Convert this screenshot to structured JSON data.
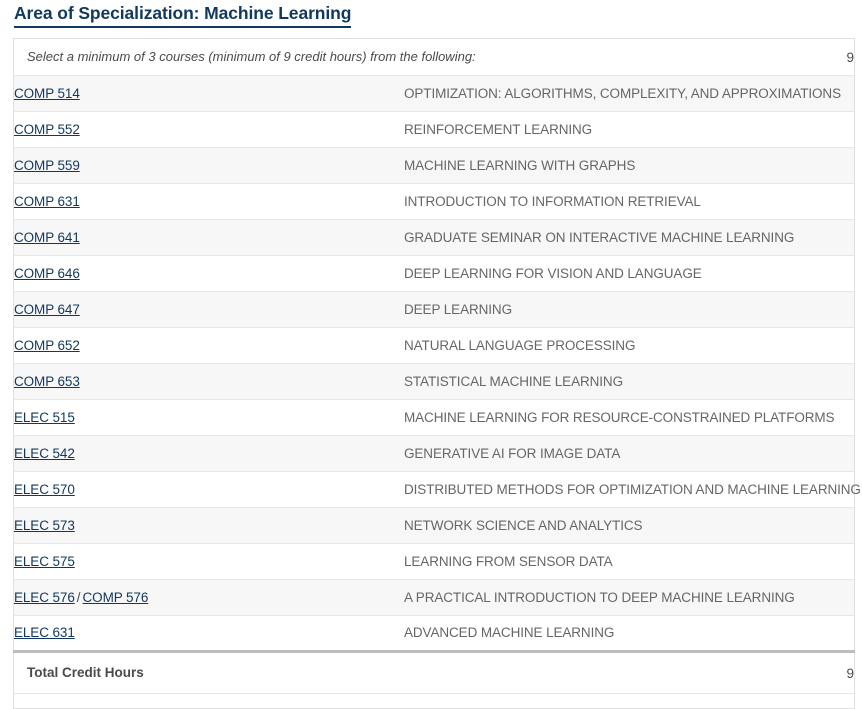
{
  "section": {
    "title": "Area of Specialization: Machine Learning"
  },
  "table": {
    "area_header": {
      "text": "Select a minimum of 3 courses (minimum of 9 credit hours) from the following:",
      "hours": "9"
    },
    "separator": "/",
    "rows": [
      {
        "codes": [
          "COMP 514"
        ],
        "title": "OPTIMIZATION: ALGORITHMS, COMPLEXITY, AND APPROXIMATIONS",
        "hours": ""
      },
      {
        "codes": [
          "COMP 552"
        ],
        "title": "REINFORCEMENT LEARNING",
        "hours": ""
      },
      {
        "codes": [
          "COMP 559"
        ],
        "title": "MACHINE LEARNING WITH GRAPHS",
        "hours": ""
      },
      {
        "codes": [
          "COMP 631"
        ],
        "title": "INTRODUCTION TO INFORMATION RETRIEVAL",
        "hours": ""
      },
      {
        "codes": [
          "COMP 641"
        ],
        "title": "GRADUATE SEMINAR ON INTERACTIVE MACHINE LEARNING",
        "hours": ""
      },
      {
        "codes": [
          "COMP 646"
        ],
        "title": "DEEP LEARNING FOR VISION AND LANGUAGE",
        "hours": ""
      },
      {
        "codes": [
          "COMP 647"
        ],
        "title": "DEEP LEARNING",
        "hours": ""
      },
      {
        "codes": [
          "COMP 652"
        ],
        "title": "NATURAL LANGUAGE PROCESSING",
        "hours": ""
      },
      {
        "codes": [
          "COMP 653"
        ],
        "title": "STATISTICAL MACHINE LEARNING",
        "hours": ""
      },
      {
        "codes": [
          "ELEC 515"
        ],
        "title": "MACHINE LEARNING FOR RESOURCE-CONSTRAINED PLATFORMS",
        "hours": ""
      },
      {
        "codes": [
          "ELEC 542"
        ],
        "title": "GENERATIVE AI FOR IMAGE DATA",
        "hours": ""
      },
      {
        "codes": [
          "ELEC 570"
        ],
        "title": "DISTRIBUTED METHODS FOR OPTIMIZATION AND MACHINE LEARNING",
        "hours": ""
      },
      {
        "codes": [
          "ELEC 573"
        ],
        "title": "NETWORK SCIENCE AND ANALYTICS",
        "hours": ""
      },
      {
        "codes": [
          "ELEC 575"
        ],
        "title": "LEARNING FROM SENSOR DATA",
        "hours": ""
      },
      {
        "codes": [
          "ELEC 576",
          "COMP 576"
        ],
        "title": "A PRACTICAL INTRODUCTION TO DEEP MACHINE LEARNING",
        "hours": ""
      },
      {
        "codes": [
          "ELEC 631"
        ],
        "title": "ADVANCED MACHINE LEARNING",
        "hours": ""
      }
    ],
    "total": {
      "label": "Total Credit Hours",
      "hours": "9"
    }
  },
  "colors": {
    "link": "#11385f",
    "title_text": "#666666",
    "row_stripe": "#f7f7f7",
    "border": "#e5e5e5",
    "total_border": "#bdbdbd"
  }
}
